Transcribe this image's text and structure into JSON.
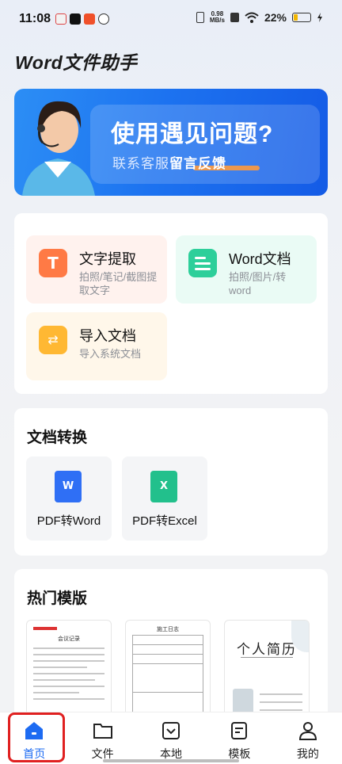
{
  "status": {
    "time": "11:08",
    "net_speed_value": "0.98",
    "net_speed_unit": "MB/s",
    "battery": "22%"
  },
  "app_title": "Word文件助手",
  "banner": {
    "title": "使用遇见问题?",
    "sub_prefix": "联系客服",
    "sub_link": "留言反馈"
  },
  "tools": [
    {
      "title": "文字提取",
      "desc": "拍照/笔记/截图提取文字",
      "icon": "text-extract-icon",
      "color": "#ff7a45",
      "bg": "#fff2ee"
    },
    {
      "title": "Word文档",
      "desc": "拍照/图片/转word",
      "icon": "word-doc-icon",
      "color": "#2dcf9a",
      "bg": "#eafbf5"
    },
    {
      "title": "导入文档",
      "desc": "导入系统文档",
      "icon": "import-folder-icon",
      "color": "#ffb833",
      "bg": "#fff7ea"
    }
  ],
  "conversion": {
    "title": "文档转换",
    "items": [
      {
        "label": "PDF转Word",
        "icon": "word-file-icon",
        "color": "#2f6ff5"
      },
      {
        "label": "PDF转Excel",
        "icon": "excel-file-icon",
        "color": "#22c08c"
      }
    ]
  },
  "templates": {
    "title": "热门模版",
    "items": [
      {
        "name": "会议记录"
      },
      {
        "name": "施工日志"
      },
      {
        "name": "个人简历"
      }
    ]
  },
  "nav": [
    {
      "label": "首页",
      "icon": "home-icon",
      "active": true
    },
    {
      "label": "文件",
      "icon": "folder-icon",
      "active": false
    },
    {
      "label": "本地",
      "icon": "local-icon",
      "active": false
    },
    {
      "label": "模板",
      "icon": "template-icon",
      "active": false
    },
    {
      "label": "我的",
      "icon": "user-icon",
      "active": false
    }
  ],
  "colors": {
    "accent": "#1d6bf2",
    "highlight": "#e02020"
  }
}
